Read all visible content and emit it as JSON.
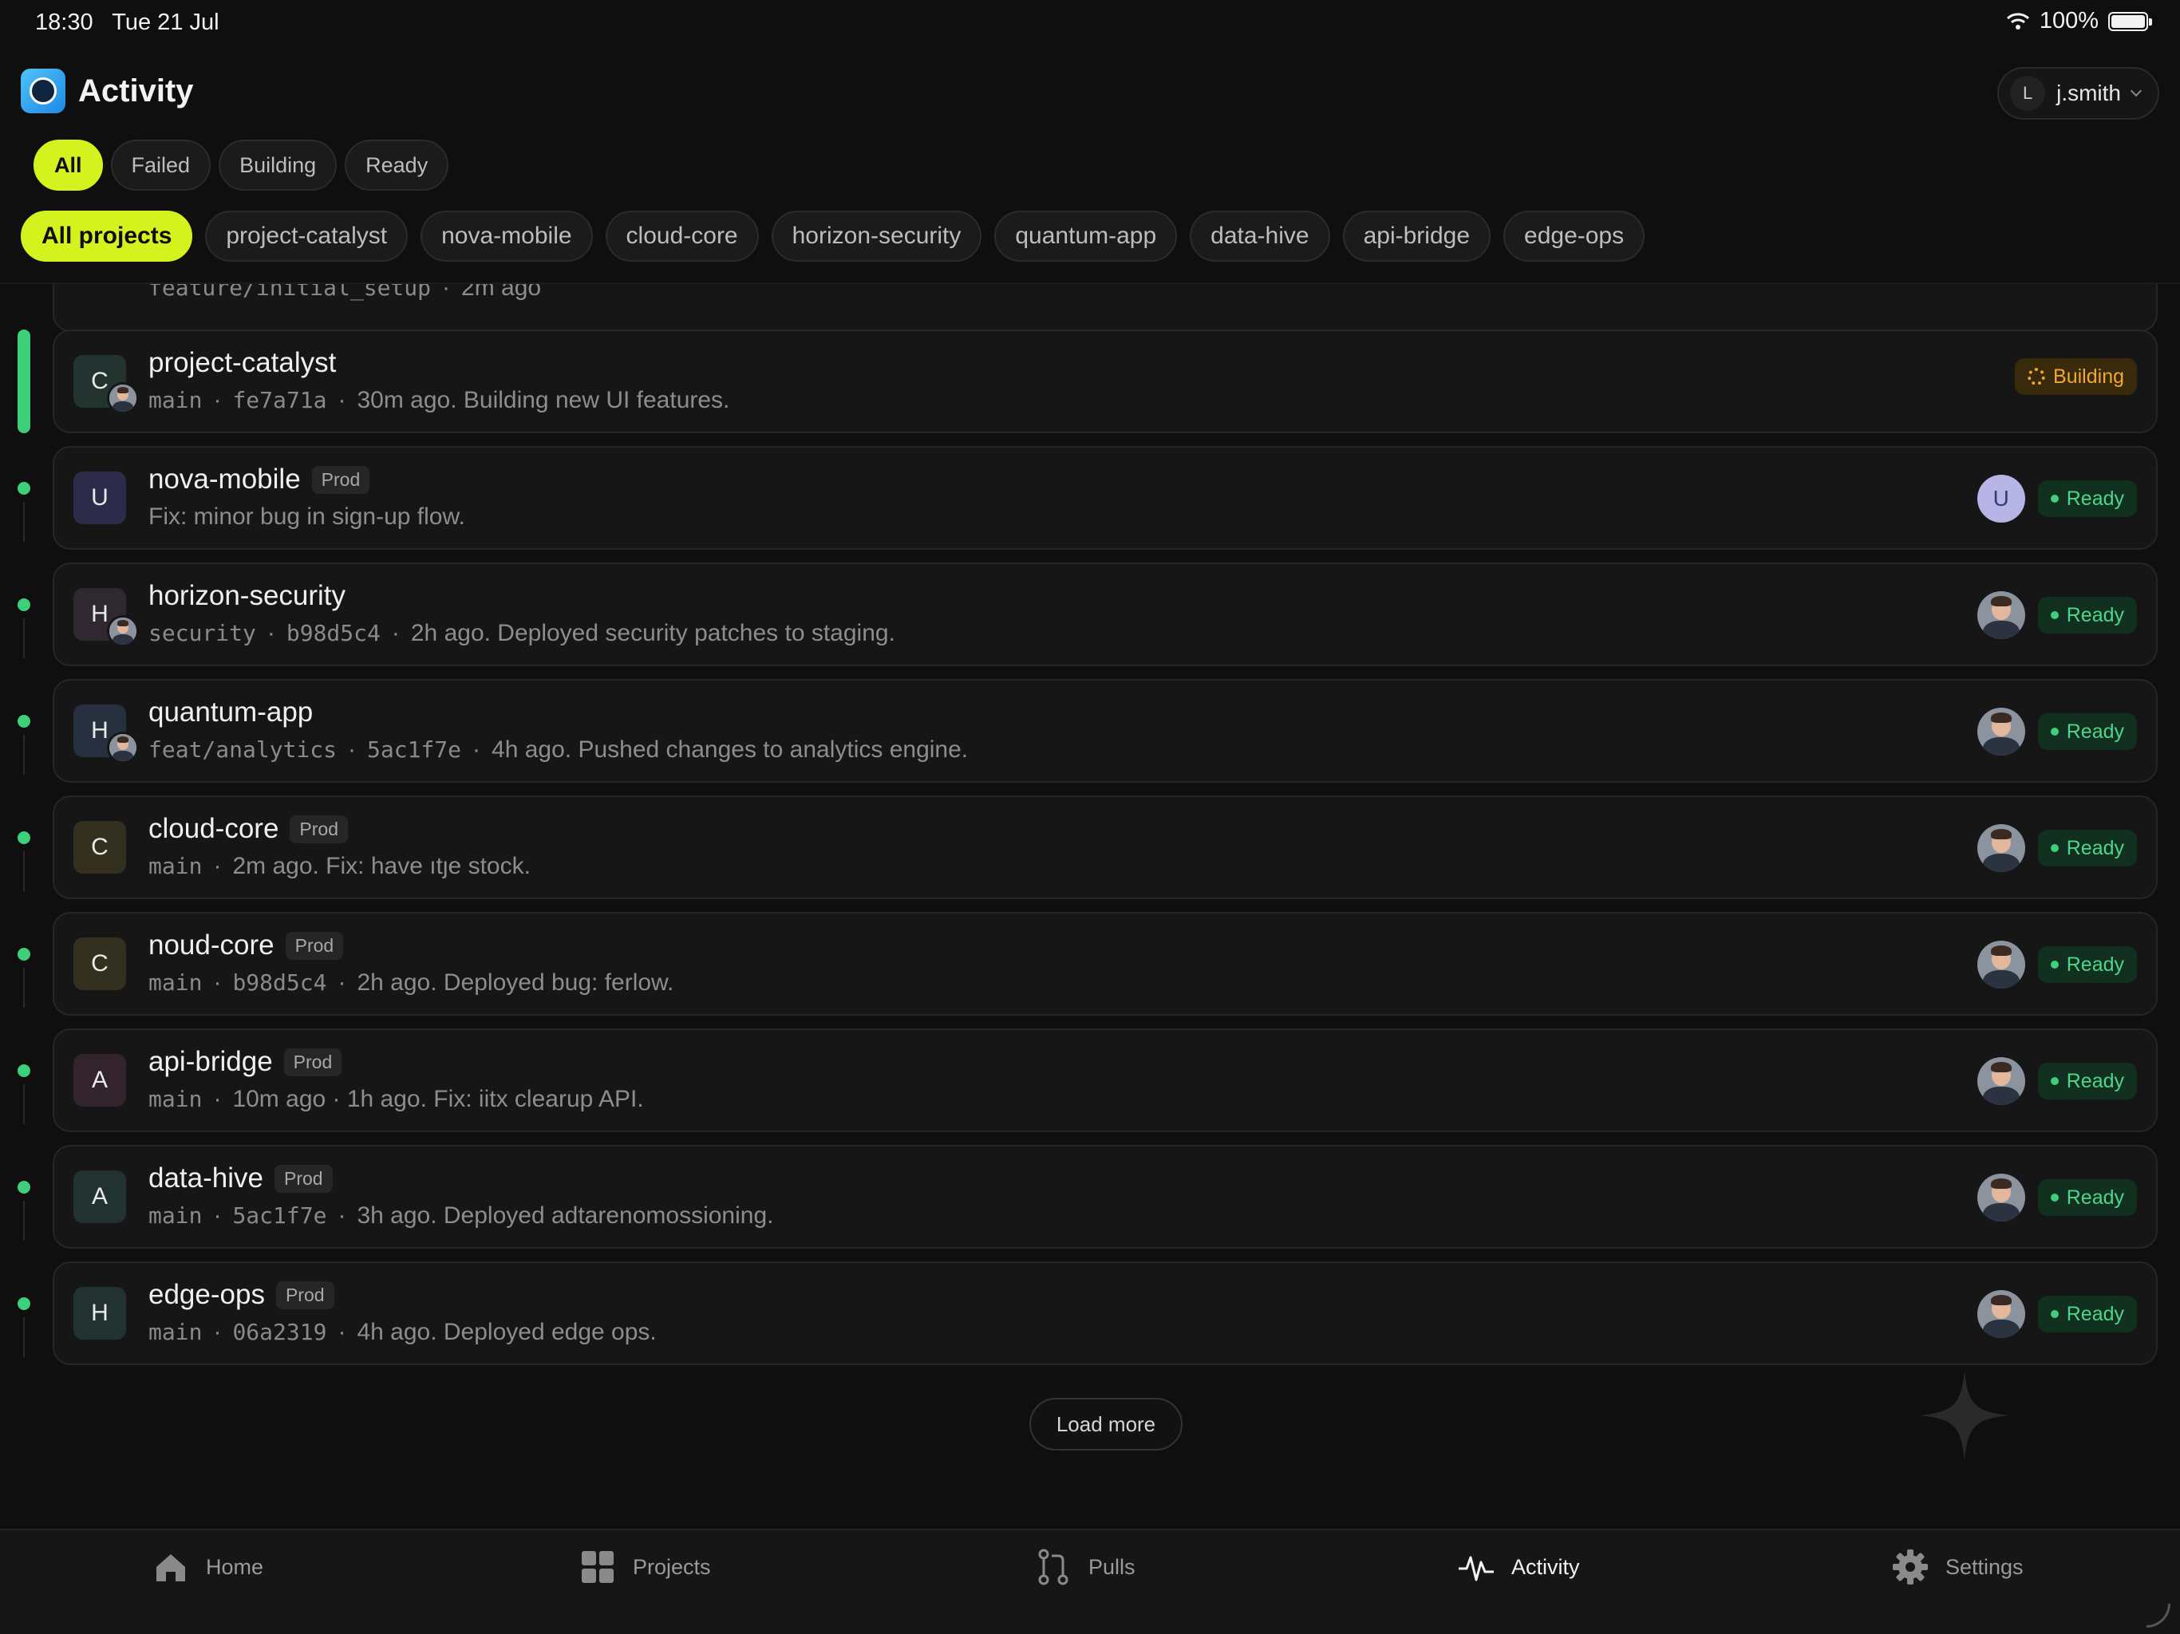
{
  "status_bar": {
    "time": "18:30",
    "date": "Tue 21 Jul",
    "battery": "100%",
    "wifi_icon": "wifi-icon"
  },
  "header": {
    "title": "Activity",
    "user": {
      "initial": "L",
      "name": "j.smith"
    }
  },
  "status_filters": [
    {
      "label": "All",
      "active": true
    },
    {
      "label": "Failed",
      "active": false
    },
    {
      "label": "Building",
      "active": false
    },
    {
      "label": "Ready",
      "active": false
    }
  ],
  "project_filters": [
    {
      "label": "All projects",
      "active": true
    },
    {
      "label": "project-catalyst",
      "active": false
    },
    {
      "label": "nova-mobile",
      "active": false
    },
    {
      "label": "cloud-core",
      "active": false
    },
    {
      "label": "horizon-security",
      "active": false
    },
    {
      "label": "quantum-app",
      "active": false
    },
    {
      "label": "data-hive",
      "active": false
    },
    {
      "label": "api-bridge",
      "active": false
    },
    {
      "label": "edge-ops",
      "active": false
    }
  ],
  "partial_row": {
    "branch": "feature/initial_setup",
    "time": "2m ago"
  },
  "activity": [
    {
      "initial": "C",
      "name": "project-catalyst",
      "tag": "",
      "branch": "main",
      "commit": "fe7a71a",
      "message": "30m ago. Building new UI features.",
      "status": "Building",
      "actor": "photo",
      "actor_letter": "",
      "color": "#23332f",
      "mini": true
    },
    {
      "initial": "U",
      "name": "nova-mobile",
      "tag": "Prod",
      "branch": "",
      "commit": "",
      "message": "Fix: minor bug in sign-up flow.",
      "status": "Ready",
      "actor": "letter",
      "actor_letter": "U",
      "color": "#2c2c4a",
      "mini": false
    },
    {
      "initial": "H",
      "name": "horizon-security",
      "tag": "",
      "branch": "security",
      "commit": "b98d5c4",
      "message": "2h ago. Deployed security patches to staging.",
      "status": "Ready",
      "actor": "photo",
      "actor_letter": "",
      "color": "#2f2830",
      "mini": true
    },
    {
      "initial": "H",
      "name": "quantum-app",
      "tag": "",
      "branch": "feat/analytics",
      "commit": "5ac1f7e",
      "message": "4h ago. Pushed changes to analytics engine.",
      "status": "Ready",
      "actor": "photo",
      "actor_letter": "",
      "color": "#26303f",
      "mini": true
    },
    {
      "initial": "C",
      "name": "cloud-core",
      "tag": "Prod",
      "branch": "main",
      "commit": "",
      "message": "2m ago. Fix: have ıtȷe stock.",
      "status": "Ready",
      "actor": "photo",
      "actor_letter": "",
      "color": "#34301f",
      "mini": false
    },
    {
      "initial": "C",
      "name": "noud-core",
      "tag": "Prod",
      "branch": "main",
      "commit": "b98d5c4",
      "message": "2h ago. Deployed bug: ferlow.",
      "status": "Ready",
      "actor": "photo",
      "actor_letter": "",
      "color": "#34301f",
      "mini": false
    },
    {
      "initial": "A",
      "name": "api-bridge",
      "tag": "Prod",
      "branch": "main",
      "commit": "",
      "message": "10m ago · 1h ago. Fix: iitx clearup API.",
      "status": "Ready",
      "actor": "photo",
      "actor_letter": "",
      "color": "#33232d",
      "mini": false
    },
    {
      "initial": "A",
      "name": "data-hive",
      "tag": "Prod",
      "branch": "main",
      "commit": "5ac1f7e",
      "message": "3h ago. Deployed adtarenomossioning.",
      "status": "Ready",
      "actor": "photo",
      "actor_letter": "",
      "color": "#223230",
      "mini": false
    },
    {
      "initial": "H",
      "name": "edge-ops",
      "tag": "Prod",
      "branch": "main",
      "commit": "06a2319",
      "message": "4h ago. Deployed edge ops.",
      "status": "Ready",
      "actor": "photo",
      "actor_letter": "",
      "color": "#223230",
      "mini": false
    }
  ],
  "load_more_label": "Load more",
  "tabs": [
    {
      "label": "Home",
      "icon": "home-icon",
      "active": false
    },
    {
      "label": "Projects",
      "icon": "grid-icon",
      "active": false
    },
    {
      "label": "Pulls",
      "icon": "pull-request-icon",
      "active": false
    },
    {
      "label": "Activity",
      "icon": "activity-icon",
      "active": true
    },
    {
      "label": "Settings",
      "icon": "gear-icon",
      "active": false
    }
  ],
  "colors": {
    "accent": "#d4f21e",
    "ready": "#3ecf7a",
    "building": "#f0a733"
  }
}
